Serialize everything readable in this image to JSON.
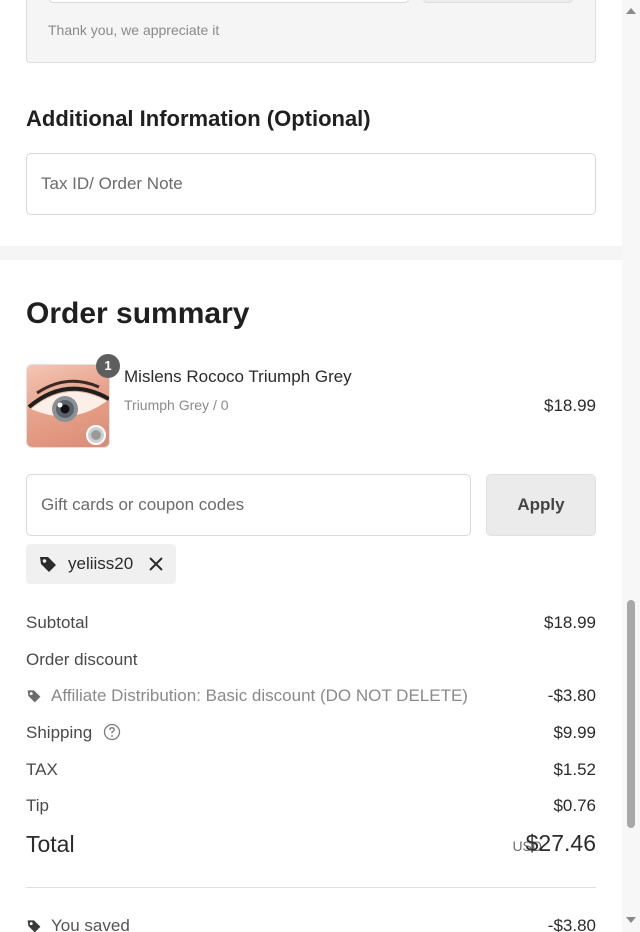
{
  "tip_section": {
    "thanks_text": "Thank you, we appreciate it"
  },
  "additional_info": {
    "heading": "Additional Information (Optional)",
    "note_placeholder": "Tax ID/ Order Note"
  },
  "order_summary": {
    "title": "Order summary",
    "items": [
      {
        "name": "Mislens Rococo Triumph Grey",
        "variant": "Triumph Grey / 0",
        "price": "$18.99",
        "quantity": "1",
        "thumbnail_icon": "contact-lens-eye-image"
      }
    ],
    "coupon": {
      "placeholder": "Gift cards or coupon codes",
      "apply_label": "Apply"
    },
    "applied_code": {
      "code": "yeliiss20",
      "tag_icon": "tag-icon",
      "remove_icon": "close-icon"
    },
    "lines": {
      "subtotal_label": "Subtotal",
      "subtotal_value": "$18.99",
      "discount_label": "Order discount",
      "discount_detail_label": "Affiliate Distribution: Basic discount (DO NOT DELETE)",
      "discount_detail_value": "-$3.80",
      "shipping_label": "Shipping",
      "shipping_value": "$9.99",
      "tax_label": "TAX",
      "tax_value": "$1.52",
      "tip_label": "Tip",
      "tip_value": "$0.76"
    },
    "total": {
      "label": "Total",
      "currency": "USD",
      "value": "$27.46"
    },
    "savings": {
      "label": "You saved",
      "value": "-$3.80"
    }
  },
  "colors": {
    "background": "#ffffff",
    "panel": "#f5f5f5",
    "border": "#d9d9d9",
    "text_primary": "#2b2b2b",
    "text_muted": "#8a8a8a",
    "badge": "#5e5e5e"
  }
}
